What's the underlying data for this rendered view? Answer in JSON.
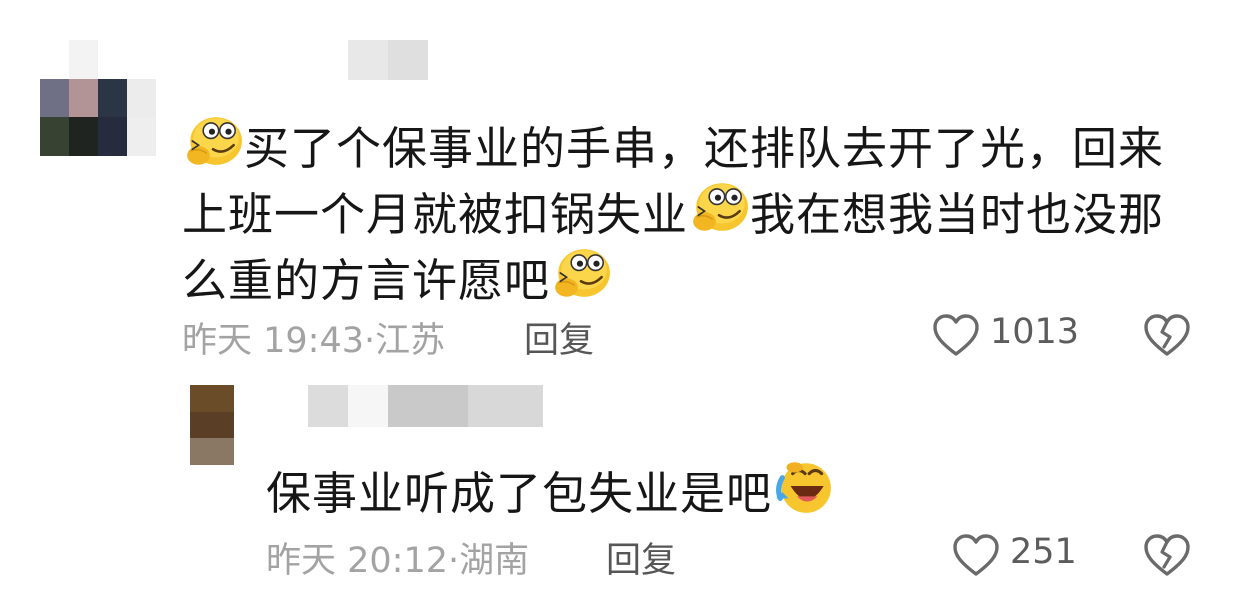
{
  "comments": [
    {
      "text_segments": [
        "买了个保事业的手串，还排队去开了光，回来",
        "上班一个月就被扣锅失业",
        "我在想我当时也没那",
        "么重的方言许愿吧"
      ],
      "emoji": "thinking-smirk-emoji",
      "timestamp": "昨天 19:43",
      "separator": "·",
      "location": "江苏",
      "reply_label": "回复",
      "like_count": "1013"
    },
    {
      "text": "保事业听成了包失业是吧",
      "emoji": "laughing-tears-emoji",
      "timestamp": "昨天 20:12",
      "separator": "·",
      "location": "湖南",
      "reply_label": "回复",
      "like_count": "251"
    }
  ],
  "icons": {
    "like": "heart-outline-icon",
    "dislike": "broken-heart-icon"
  },
  "colors": {
    "text": "#161616",
    "meta": "#a3a3a3",
    "reply": "#565656",
    "icon": "#6a6a6a",
    "emoji_yellow": "#f7c62f"
  }
}
